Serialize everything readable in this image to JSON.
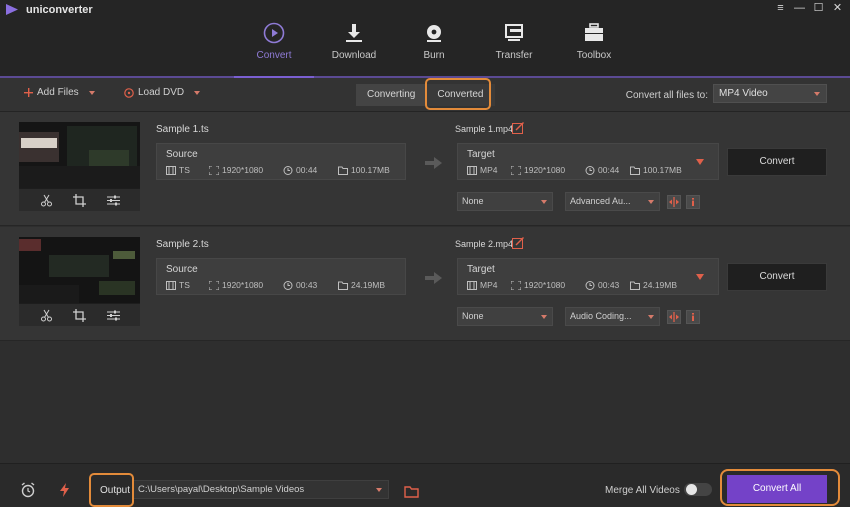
{
  "app": {
    "title": "uniconverter"
  },
  "window_controls": [
    "≡",
    "—",
    "☐",
    "✕"
  ],
  "nav": [
    {
      "label": "Convert",
      "icon": "play-circle-icon",
      "active": true
    },
    {
      "label": "Download",
      "icon": "download-icon",
      "active": false
    },
    {
      "label": "Burn",
      "icon": "disc-icon",
      "active": false
    },
    {
      "label": "Transfer",
      "icon": "transfer-icon",
      "active": false
    },
    {
      "label": "Toolbox",
      "icon": "toolbox-icon",
      "active": false
    }
  ],
  "toolbar": {
    "add_files": "Add Files",
    "load_dvd": "Load DVD",
    "tabs": [
      "Converting",
      "Converted"
    ],
    "convert_all_label": "Convert all files to:",
    "format": "MP4 Video"
  },
  "files": [
    {
      "name": "Sample 1.ts",
      "source": {
        "title": "Source",
        "format": "TS",
        "resolution": "1920*1080",
        "duration": "00:44",
        "size": "100.17MB"
      },
      "target_name": "Sample 1.mp4",
      "target": {
        "title": "Target",
        "format": "MP4",
        "resolution": "1920*1080",
        "duration": "00:44",
        "size": "100.17MB"
      },
      "subtitle": "None",
      "audio": "Advanced Au...",
      "convert_label": "Convert"
    },
    {
      "name": "Sample 2.ts",
      "source": {
        "title": "Source",
        "format": "TS",
        "resolution": "1920*1080",
        "duration": "00:43",
        "size": "24.19MB"
      },
      "target_name": "Sample 2.mp4",
      "target": {
        "title": "Target",
        "format": "MP4",
        "resolution": "1920*1080",
        "duration": "00:43",
        "size": "24.19MB"
      },
      "subtitle": "None",
      "audio": "Audio Coding...",
      "convert_label": "Convert"
    }
  ],
  "bottom": {
    "output_label": "Output",
    "output_path": "C:\\Users\\payal\\Desktop\\Sample Videos",
    "merge_label": "Merge All Videos",
    "merge_enabled": false,
    "convert_all": "Convert All"
  },
  "colors": {
    "accent_purple": "#7442c8",
    "highlight_orange": "#e38b3a",
    "icon_red": "#e0604a"
  }
}
